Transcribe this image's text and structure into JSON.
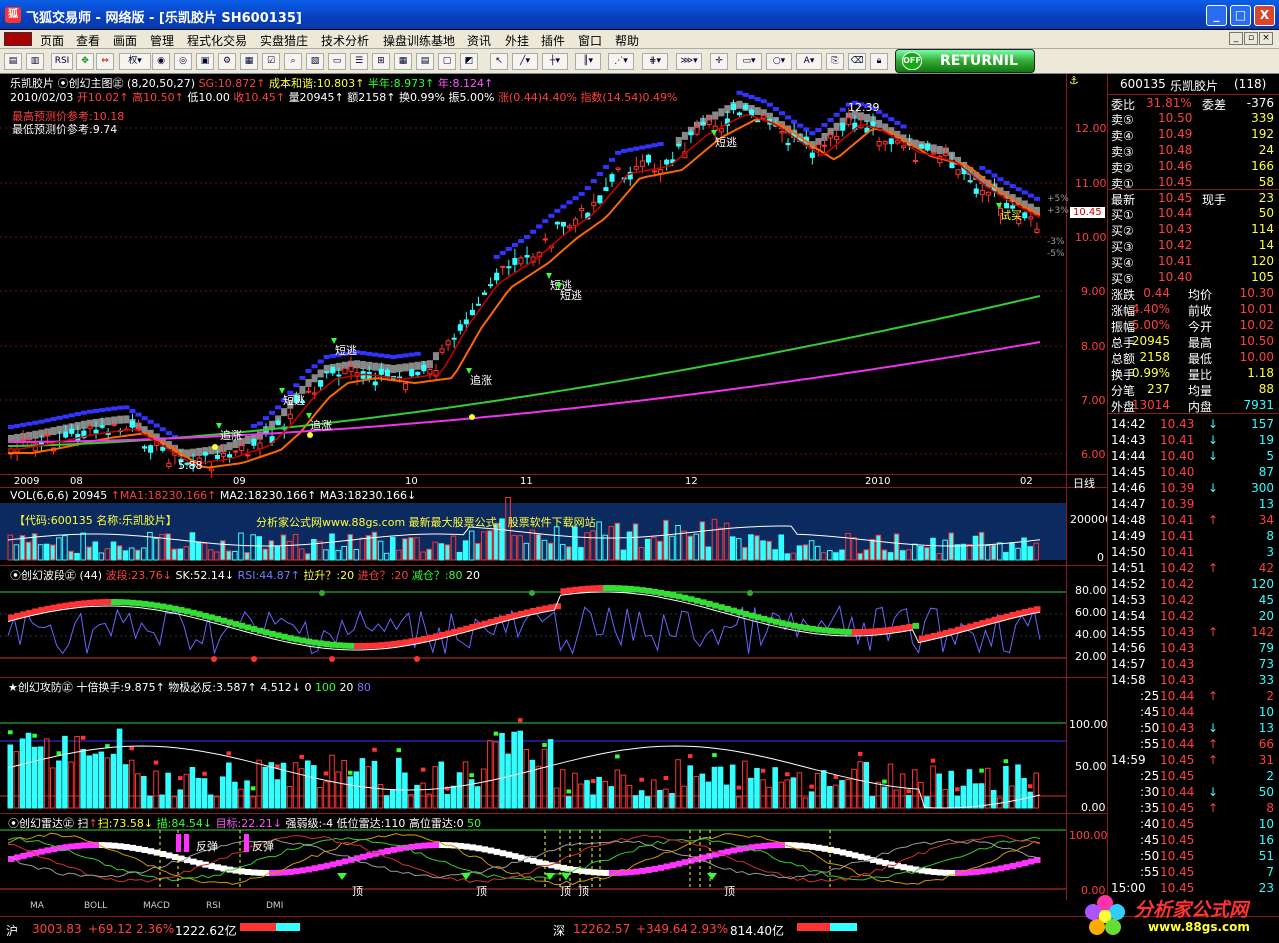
{
  "window": {
    "title": "飞狐交易师 - 网络版 - [乐凯胶片 SH600135]",
    "min": "_",
    "max": "□",
    "close": "X"
  },
  "menu": [
    "页面",
    "查看",
    "画面",
    "管理",
    "程式化交易",
    "实盘猎庄",
    "技术分析",
    "操盘训练基地",
    "资讯",
    "外挂",
    "插件",
    "窗口",
    "帮助"
  ],
  "toolbar": {
    "quan": "权",
    "rsi": "RSI",
    "return_label": "RETURNIL",
    "off": "OFF"
  },
  "main": {
    "name": "乐凯胶片",
    "indicator": "创幻主图",
    "params": "(8,20,50,27)",
    "sg": "SG:10.872",
    "cost": "成本和谐:10.803",
    "half": "半年:8.973",
    "year": "年:8.124",
    "date": "2010/02/03",
    "open": "开10.02",
    "high": "高10.50",
    "low": "低10.00",
    "close": "收10.45",
    "vol": "量20945",
    "amt": "额2158",
    "turn": "换0.99%",
    "amp": "振5.00%",
    "chg": "涨(0.44)4.40%",
    "idx": "指数(14.54)0.49%",
    "pred_high": "最高预测价参考:10.18",
    "pred_low": "最低预测价参考:9.74",
    "peak": "12.39",
    "trough": "5.88",
    "yaxis": [
      "12.00",
      "11.00",
      "10.00",
      "9.00",
      "8.00",
      "7.00",
      "6.00"
    ],
    "pct": [
      "+5%",
      "+3%",
      "-3%",
      "-5%"
    ],
    "price_tag": "10.45",
    "xaxis": [
      "2009",
      "08",
      "09",
      "10",
      "11",
      "12",
      "2010",
      "02"
    ],
    "xlabel": "日线",
    "signals": [
      {
        "t": "短逃"
      },
      {
        "t": "短逃"
      },
      {
        "t": "短逃"
      },
      {
        "t": "短逃"
      },
      {
        "t": "短逃"
      },
      {
        "t": "追涨"
      },
      {
        "t": "追涨"
      },
      {
        "t": "追涨"
      },
      {
        "t": "试买"
      }
    ]
  },
  "vol": {
    "label": "VOL(6,6,6)",
    "v": "20945",
    "ma1": "MA1:18230.166",
    "ma2": "MA2:18230.166",
    "ma3": "MA3:18230.166",
    "code": "【代码:600135 名称:乐凯胶片】",
    "ad": "分析家公式网www.88gs.com 最新最大股票公式，股票软件下载网站",
    "ax": [
      "200000",
      "0"
    ]
  },
  "wave": {
    "label": "创幻波段",
    "p": "(44)",
    "bd": "波段:23.76",
    "sk": "SK:52.14",
    "rsi": "RSI:44.87",
    "ls": "拉升？:20",
    "jc": "进仓？:20",
    "rc": "减仓？:80",
    "n": "20",
    "ax": [
      "80.00",
      "60.00",
      "40.00",
      "20.00"
    ]
  },
  "defense": {
    "label": "★创幻攻防",
    "a": "十倍换手:9.875",
    "b": "物极必反:3.587",
    "c": "4.512",
    "d": "0",
    "e": "100",
    "f": "20",
    "g": "80",
    "ax": [
      "100.00",
      "50.00",
      "0.00"
    ]
  },
  "radar": {
    "label": "创幻雷达",
    "s": "扫:73.58",
    "m": "描:84.54",
    "t": "目标:22.21",
    "q": "强弱级:-4",
    "lw": "低位雷达:110",
    "hw": "高位雷达:0",
    "n": "50",
    "fan": "反弹",
    "ding": "顶",
    "ax": [
      "100.00",
      "0.00"
    ]
  },
  "tabs": [
    "MA",
    "BOLL",
    "MACD",
    "RSI",
    "DMI"
  ],
  "quote": {
    "code": "600135",
    "name": "乐凯胶片",
    "num": "(118)",
    "weibi": "委比",
    "wb": "31.81%",
    "weicha": "委差",
    "wc": "-376",
    "sell": [
      [
        "卖⑤",
        "10.50",
        "339"
      ],
      [
        "卖④",
        "10.49",
        "192"
      ],
      [
        "卖③",
        "10.48",
        "24"
      ],
      [
        "卖②",
        "10.46",
        "166"
      ],
      [
        "卖①",
        "10.45",
        "58"
      ]
    ],
    "zuixin": "最新",
    "zx": "10.45",
    "xianshou": "现手",
    "xs": "23",
    "buy": [
      [
        "买①",
        "10.44",
        "50"
      ],
      [
        "买②",
        "10.43",
        "114"
      ],
      [
        "买③",
        "10.42",
        "14"
      ],
      [
        "买④",
        "10.41",
        "120"
      ],
      [
        "买⑤",
        "10.40",
        "105"
      ]
    ],
    "stats": [
      [
        "涨跌",
        "0.44",
        "均价",
        "10.30"
      ],
      [
        "涨幅",
        "4.40%",
        "前收",
        "10.01"
      ],
      [
        "振幅",
        "5.00%",
        "今开",
        "10.02"
      ],
      [
        "总手",
        "20945",
        "最高",
        "10.50"
      ],
      [
        "总额",
        "2158",
        "最低",
        "10.00"
      ],
      [
        "换手",
        "0.99%",
        "量比",
        "1.18"
      ],
      [
        "分笔",
        "237",
        "均量",
        "88"
      ],
      [
        "外盘",
        "13014",
        "内盘",
        "7931"
      ]
    ],
    "ticks": [
      [
        "14:42",
        "10.43",
        "↓",
        "157"
      ],
      [
        "14:43",
        "10.41",
        "↓",
        "19"
      ],
      [
        "14:44",
        "10.40",
        "↓",
        "5"
      ],
      [
        "14:45",
        "10.40",
        "",
        "87"
      ],
      [
        "14:46",
        "10.39",
        "↓",
        "300"
      ],
      [
        "14:47",
        "10.39",
        "",
        "13"
      ],
      [
        "14:48",
        "10.41",
        "↑",
        "34"
      ],
      [
        "14:49",
        "10.41",
        "",
        "8"
      ],
      [
        "14:50",
        "10.41",
        "",
        "3"
      ],
      [
        "14:51",
        "10.42",
        "↑",
        "42"
      ],
      [
        "14:52",
        "10.42",
        "",
        "120"
      ],
      [
        "14:53",
        "10.42",
        "",
        "45"
      ],
      [
        "14:54",
        "10.42",
        "",
        "20"
      ],
      [
        "14:55",
        "10.43",
        "↑",
        "142"
      ],
      [
        "14:56",
        "10.43",
        "",
        "79"
      ],
      [
        "14:57",
        "10.43",
        "",
        "73"
      ],
      [
        "14:58",
        "10.43",
        "",
        "33"
      ],
      [
        ":25",
        "10.44",
        "↑",
        "2"
      ],
      [
        ":45",
        "10.44",
        "",
        "10"
      ],
      [
        ":50",
        "10.43",
        "↓",
        "13"
      ],
      [
        ":55",
        "10.44",
        "↑",
        "66"
      ],
      [
        "14:59",
        "10.45",
        "↑",
        "31"
      ],
      [
        ":25",
        "10.45",
        "",
        "2"
      ],
      [
        ":30",
        "10.44",
        "↓",
        "50"
      ],
      [
        ":35",
        "10.45",
        "↑",
        "8"
      ],
      [
        ":40",
        "10.45",
        "",
        "10"
      ],
      [
        ":45",
        "10.45",
        "",
        "16"
      ],
      [
        ":50",
        "10.45",
        "",
        "51"
      ],
      [
        ":55",
        "10.45",
        "",
        "7"
      ],
      [
        "15:00",
        "10.45",
        "",
        "23"
      ]
    ]
  },
  "status": {
    "sh": "沪",
    "sh_v": "3003.83",
    "sh_c": "+69.12",
    "sh_p": "2.36%",
    "sh_a": "1222.62亿",
    "sz": "深",
    "sz_v": "12262.57",
    "sz_c": "+349.64",
    "sz_p": "2.93%",
    "sz_a": "814.40亿",
    "logo": "分析家公式网",
    "url": "www.88gs.com"
  }
}
